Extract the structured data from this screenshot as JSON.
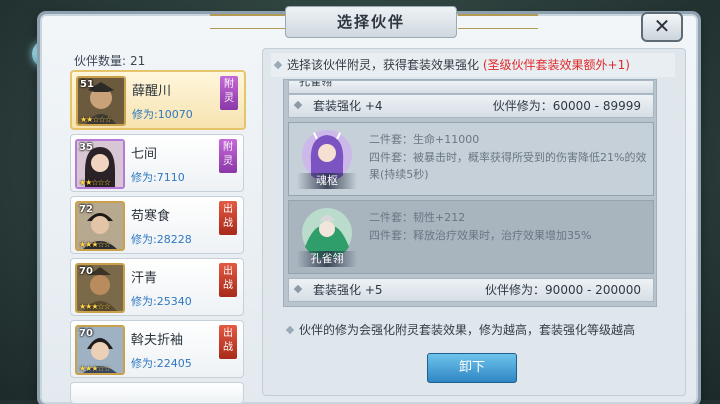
{
  "window": {
    "title": "选择伙伴",
    "close_label": "✕"
  },
  "partner_list": {
    "count_label": "伙伴数量:",
    "count_value": "21",
    "partners": [
      {
        "name": "薛醒川",
        "level": "51",
        "power": "修为:10070",
        "tag": "附灵",
        "tag_type": "attach",
        "selected": true,
        "frame": "gold"
      },
      {
        "name": "七间",
        "level": "35",
        "power": "修为:7110",
        "tag": "附灵",
        "tag_type": "attach",
        "selected": false,
        "frame": "purple"
      },
      {
        "name": "苟寒食",
        "level": "72",
        "power": "修为:28228",
        "tag": "出战",
        "tag_type": "battle",
        "selected": false,
        "frame": "gold"
      },
      {
        "name": "汗青",
        "level": "70",
        "power": "修为:25340",
        "tag": "出战",
        "tag_type": "battle",
        "selected": false,
        "frame": "gold"
      },
      {
        "name": "斡夫折袖",
        "level": "70",
        "power": "修为:22405",
        "tag": "出战",
        "tag_type": "battle",
        "selected": false,
        "frame": "gold"
      }
    ]
  },
  "info": {
    "hint": "选择该伙伴附灵，获得套装效果强化",
    "hint_highlight": "(圣级伙伴套装效果额外+1)"
  },
  "sets": {
    "top_cut_name": "孔雀翎",
    "tier4": {
      "left": "套装强化 +4",
      "right": "伙伴修为：60000 - 89999"
    },
    "cards": [
      {
        "name": "魂枢",
        "effect2": "二件套：生命+11000",
        "effect4": "四件套：被暴击时，概率获得所受到的伤害降低21%的效果(持续5秒)",
        "active": true
      },
      {
        "name": "孔雀翎",
        "effect2": "二件套：韧性+212",
        "effect4": "四件套：释放治疗效果时，治疗效果增加35%",
        "active": false
      }
    ],
    "tier5": {
      "left": "套装强化 +5",
      "right": "伙伴修为：90000 - 200000"
    }
  },
  "note": "伙伴的修为会强化附灵套装效果，修为越高，套装强化等级越高",
  "unload_label": "卸下",
  "colors": {
    "highlight_red": "#e02a2a",
    "power_blue": "#2f78c0",
    "button_blue": "#2f86c4"
  }
}
